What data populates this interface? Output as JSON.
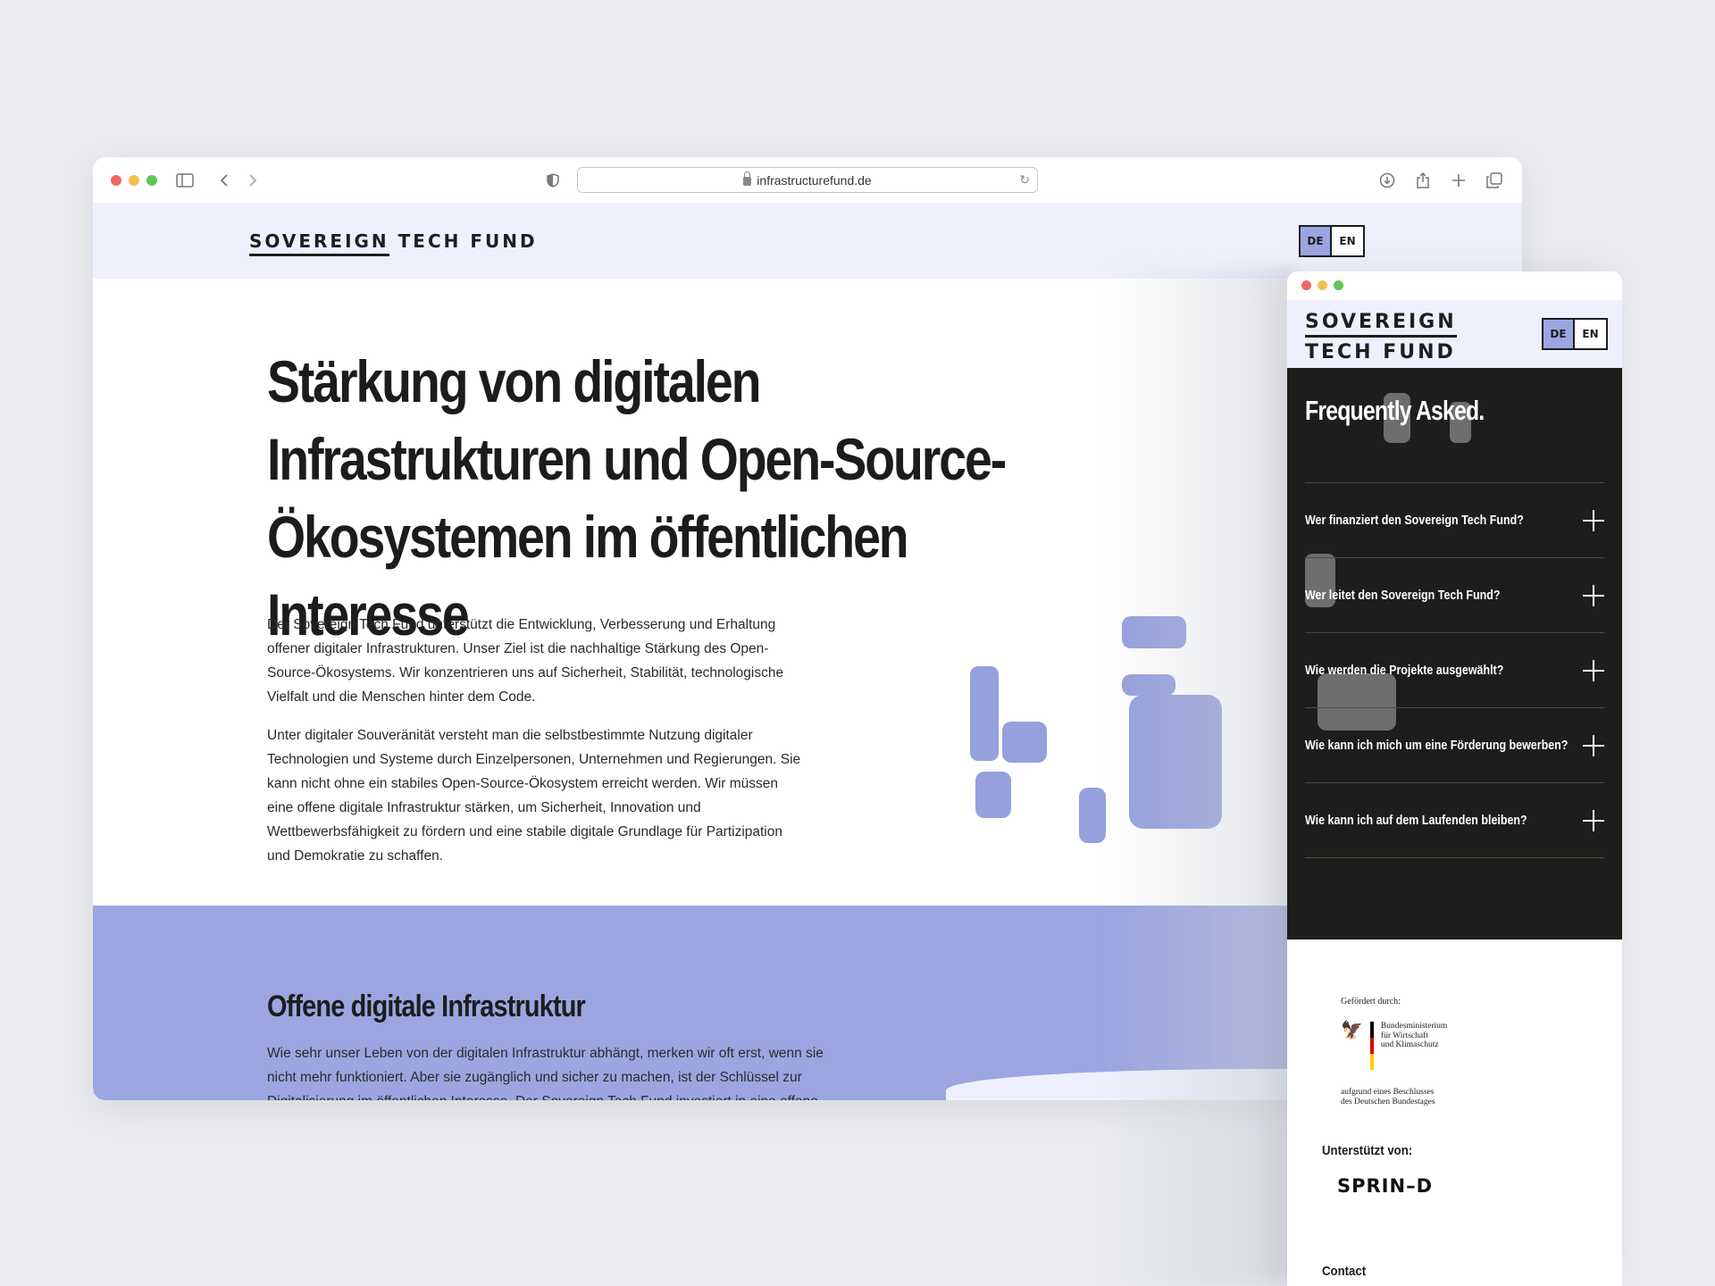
{
  "browser": {
    "url": "infrastructurefund.de"
  },
  "site": {
    "logo_word1": "SOVEREIGN",
    "logo_word2": "TECH FUND",
    "lang_de": "DE",
    "lang_en": "EN",
    "active_lang": "DE"
  },
  "hero": {
    "title": "Stärkung von digitalen Infrastrukturen und Open-Source-Ökosystemen im öffentlichen Interesse",
    "paragraph1": "Der Sovereign Tech Fund unterstützt die Entwicklung, Verbesserung und Erhaltung offener digitaler Infrastrukturen. Unser Ziel ist die nachhaltige Stärkung des Open-Source-Ökosystems. Wir konzentrieren uns auf Sicherheit, Stabilität, technologische Vielfalt und die Menschen hinter dem Code.",
    "paragraph2": "Unter digitaler Souveränität versteht man die selbstbestimmte Nutzung digitaler Technologien und Systeme durch Einzelpersonen, Unternehmen und Regierungen. Sie kann nicht ohne ein stabiles Open-Source-Ökosystem erreicht werden. Wir müssen eine offene digitale Infrastruktur stärken, um Sicherheit, Innovation und Wettbewerbsfähigkeit zu fördern und eine stabile digitale Grundlage für Partizipation und Demokratie zu schaffen."
  },
  "section2": {
    "title": "Offene digitale Infrastruktur",
    "paragraph": "Wie sehr unser Leben von der digitalen Infrastruktur abhängt, merken wir oft erst, wenn sie nicht mehr funktioniert. Aber sie zugänglich und sicher zu machen, ist der Schlüssel zur Digitalisierung im öffentlichen Interesse. Der Sovereign Tech Fund investiert in eine offene"
  },
  "mobile": {
    "logo_line1": "SOVEREIGN",
    "logo_line2": "TECH FUND",
    "faq_title": "Frequently Asked.",
    "faq_items": [
      "Wer finanziert den Sovereign Tech Fund?",
      "Wer leitet den Sovereign Tech Fund?",
      "Wie werden die Projekte ausgewählt?",
      "Wie kann ich mich um eine Förderung bewerben?",
      "Wie kann ich auf dem Laufenden bleiben?"
    ],
    "footer": {
      "funded_by": "Gefördert durch:",
      "ministry_line1": "Bundesministerium",
      "ministry_line2": "für Wirtschaft",
      "ministry_line3": "und Klimaschutz",
      "decision_line1": "aufgrund eines Beschlusses",
      "decision_line2": "des Deutschen Bundestages",
      "supported_by": "Unterstützt von:",
      "sprind": "SPRIN–D",
      "contact": "Contact"
    }
  },
  "colors": {
    "accent_lavender": "#9ba6e1",
    "header_bg": "#eef1fd",
    "faq_bg": "#1d1e1b",
    "text_dark": "#1c1c1c"
  }
}
